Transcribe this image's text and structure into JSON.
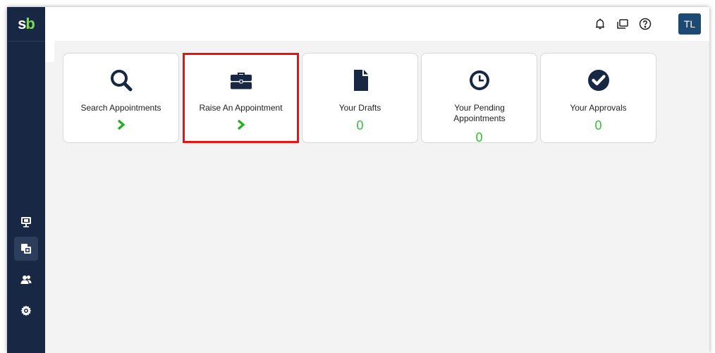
{
  "app": {
    "logo_s": "s",
    "logo_b": "b"
  },
  "sidebar": {
    "items": [
      {
        "name": "monitor"
      },
      {
        "name": "appointments"
      },
      {
        "name": "users"
      },
      {
        "name": "settings"
      }
    ]
  },
  "header": {
    "avatar_initials": "TL",
    "icons": [
      "bell-icon",
      "window-icon",
      "help-icon"
    ]
  },
  "cards": [
    {
      "label": "Search Appointments",
      "icon": "search-icon",
      "action": "arrow"
    },
    {
      "label": "Raise An Appointment",
      "icon": "briefcase-icon",
      "action": "arrow",
      "highlighted": true
    },
    {
      "label": "Your Drafts",
      "icon": "document-icon",
      "count": "0"
    },
    {
      "label": "Your Pending Appointments",
      "icon": "clock-icon",
      "count": "0"
    },
    {
      "label": "Your Approvals",
      "icon": "check-circle-icon",
      "count": "0"
    }
  ],
  "colors": {
    "sidebar": "#182744",
    "accent_green": "#31c331",
    "icon_dark": "#182744",
    "avatar": "#1c4a72",
    "highlight": "#ee1111"
  }
}
